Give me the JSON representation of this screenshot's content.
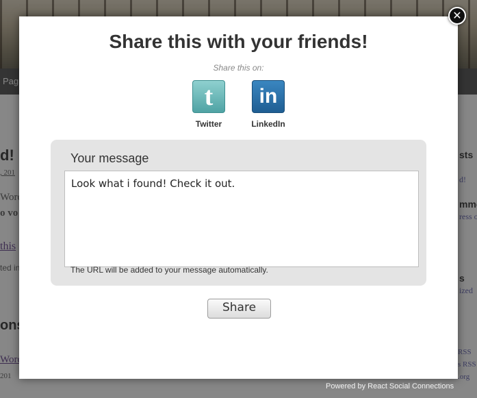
{
  "background": {
    "nav_label": "Pag",
    "fragments": {
      "heading": "d!",
      "date": ", 201",
      "word1": "Word",
      "word2": "o vo",
      "link": "this",
      "tagged": "ted in",
      "section": "ons",
      "word3": "Word",
      "date2": "201",
      "sidebar1": "sts",
      "sidebar2": "d!",
      "sidebar3": "mme",
      "sidebar4": "ress o",
      "sidebar5": "s",
      "sidebar6": "ized",
      "sidebar7": "RSS",
      "sidebar8": "s RSS",
      "sidebar9": ".org"
    }
  },
  "modal": {
    "title": "Share this with your friends!",
    "share_on_label": "Share this on:",
    "close_glyph": "✕",
    "networks": [
      {
        "label": "Twitter",
        "logo_text": "t",
        "icon": "twitter-icon"
      },
      {
        "label": "LinkedIn",
        "logo_text": "in",
        "icon": "linkedin-icon"
      }
    ],
    "message_label": "Your message",
    "message_value": "Look what i found! Check it out.",
    "url_note": "The URL will be added to your message automatically.",
    "share_button": "Share"
  },
  "footer": {
    "powered_by": "Powered by React Social Connections"
  }
}
